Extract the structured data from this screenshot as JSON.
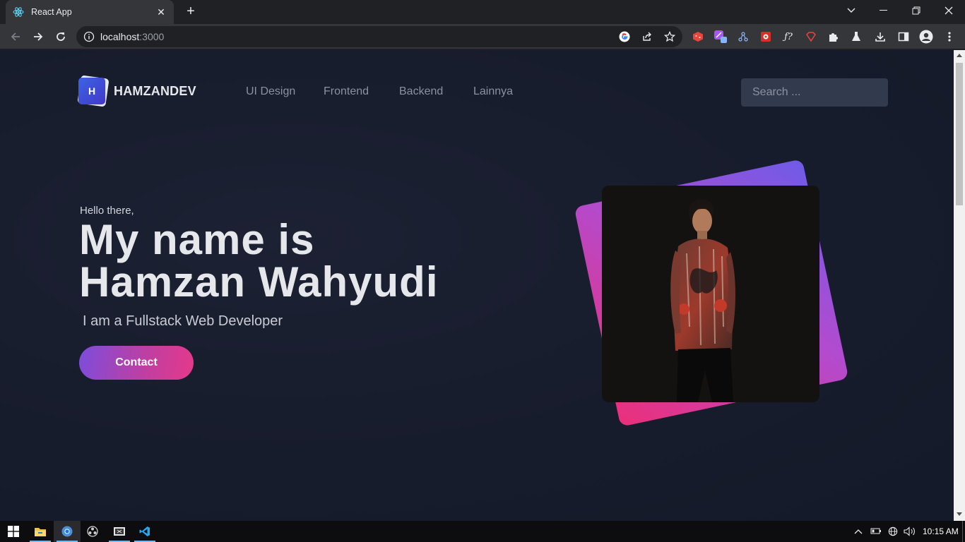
{
  "browser": {
    "tab_title": "React App",
    "url_host": "localhost",
    "url_port": ":3000"
  },
  "nav": {
    "brand_letter": "H",
    "brand_name": "HAMZANDEV",
    "links": [
      "UI Design",
      "Frontend",
      "Backend",
      "Lainnya"
    ],
    "search_placeholder": "Search ..."
  },
  "hero": {
    "greeting": "Hello there,",
    "name_line1": "My name is",
    "name_line2": "Hamzan Wahyudi",
    "role": "I am a Fullstack Web Developer",
    "cta_label": "Contact"
  },
  "taskbar": {
    "time": "10:15 AM",
    "apps": [
      "windows-start-icon",
      "file-explorer-icon",
      "chrome-icon",
      "obs-icon",
      "snipping-tool-icon",
      "vscode-icon"
    ]
  },
  "colors": {
    "page_bg": "#171c2c",
    "accent_start": "#7c4ddb",
    "accent_end": "#e5398a"
  }
}
